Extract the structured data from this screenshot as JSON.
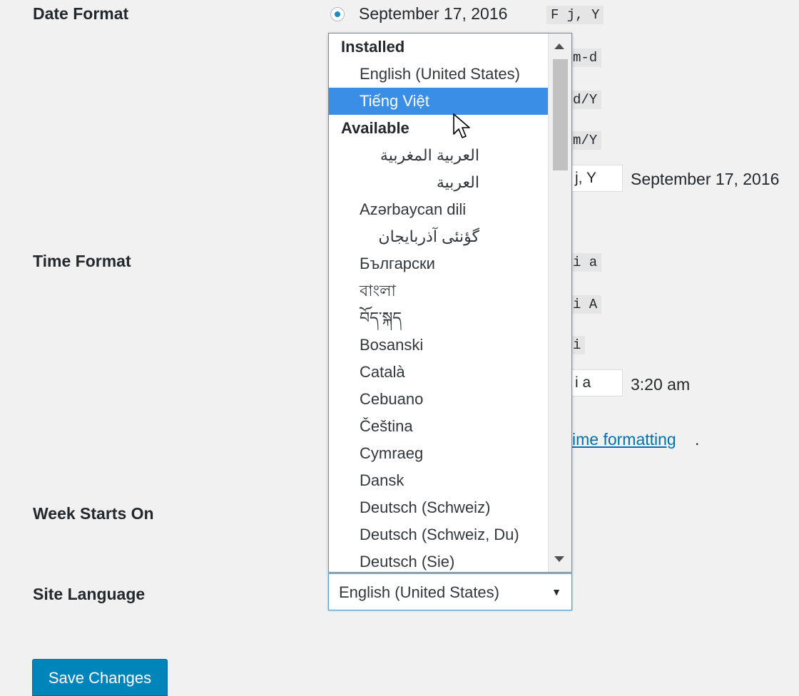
{
  "labels": {
    "date_format": "Date Format",
    "time_format": "Time Format",
    "week_starts_on": "Week Starts On",
    "site_language": "Site Language"
  },
  "date_format": {
    "option1_label": "September 17, 2016",
    "option1_code": "F j, Y",
    "codes": [
      "m-d",
      "d/Y",
      "m/Y"
    ],
    "custom_value": "j, Y",
    "custom_preview": "September 17, 2016"
  },
  "time_format": {
    "codes": [
      "i a",
      "i A",
      "i"
    ],
    "custom_value": "i a",
    "custom_preview": "3:20 am"
  },
  "doc_link": {
    "text": "ime formatting",
    "tail": "."
  },
  "language_dropdown": {
    "group_installed": "Installed",
    "installed": [
      "English (United States)",
      "Tiếng Việt"
    ],
    "highlighted": "Tiếng Việt",
    "group_available": "Available",
    "available": [
      "العربية المغربية",
      "العربية",
      "Azərbaycan dili",
      "گؤنئی آذربایجان",
      "Български",
      "বাংলা",
      "བོད་སྐད",
      "Bosanski",
      "Català",
      "Cebuano",
      "Čeština",
      "Cymraeg",
      "Dansk",
      "Deutsch (Schweiz)",
      "Deutsch (Schweiz, Du)",
      "Deutsch (Sie)"
    ]
  },
  "site_language_select": {
    "value": "English (United States)"
  },
  "save_button": {
    "label": "Save Changes"
  },
  "colors": {
    "accent": "#0085ba",
    "highlight": "#3a8ee6",
    "background": "#f1f1f1",
    "link": "#0073aa"
  },
  "icons": {
    "radio": "radio-checked-icon",
    "select_arrow": "triangle-down-icon",
    "cursor": "mouse-pointer-icon"
  }
}
